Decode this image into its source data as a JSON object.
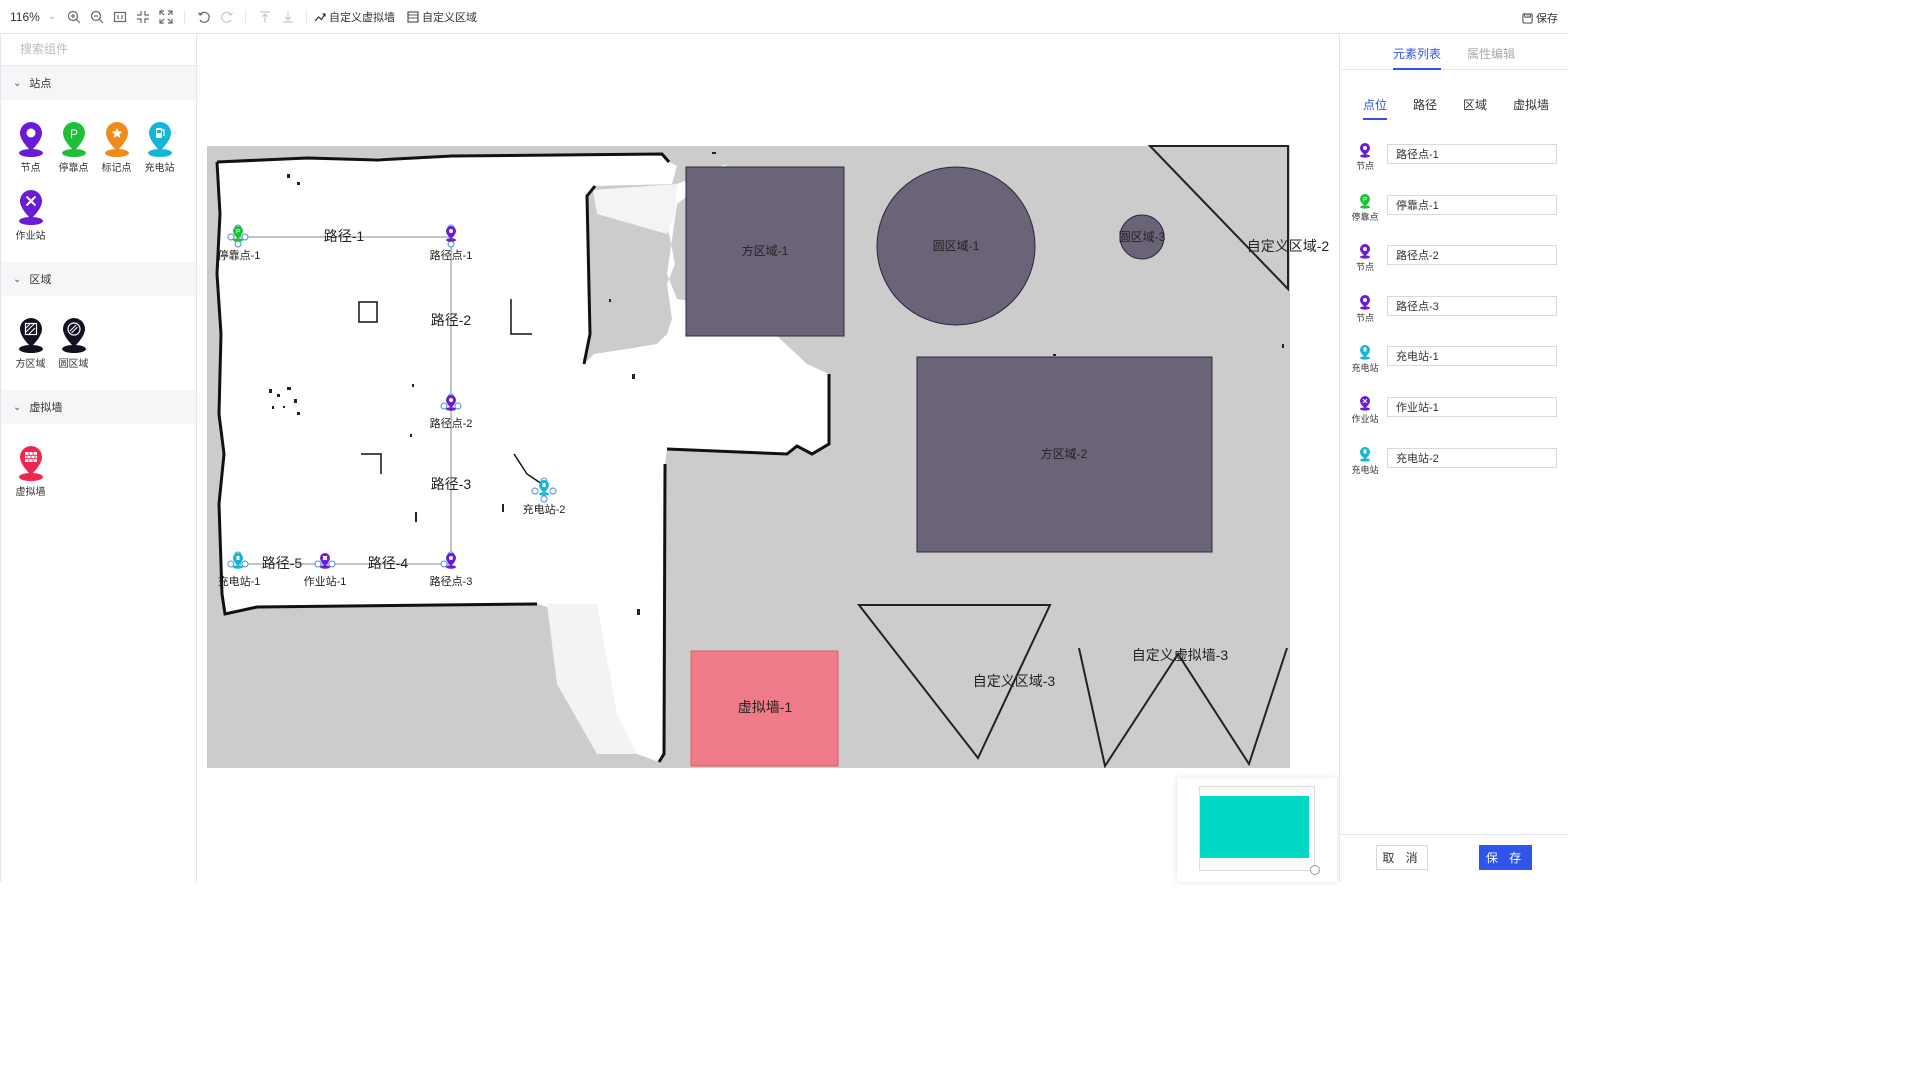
{
  "toolbar": {
    "zoom": "116%",
    "custom_wall_label": "自定义虚拟墙",
    "custom_area_label": "自定义区域",
    "save_label": "保存"
  },
  "left": {
    "search_placeholder": "搜索组件",
    "sections": [
      {
        "title": "站点",
        "items": [
          {
            "label": "节点",
            "icon": "node-pin",
            "color": "#6a1bd6"
          },
          {
            "label": "停靠点",
            "icon": "parking-pin",
            "color": "#1fbf3a"
          },
          {
            "label": "标记点",
            "icon": "star-pin",
            "color": "#f08b19"
          },
          {
            "label": "充电站",
            "icon": "charging-pin",
            "color": "#13b6d6"
          },
          {
            "label": "作业站",
            "icon": "tools-pin",
            "color": "#6a1bd6"
          }
        ]
      },
      {
        "title": "区域",
        "items": [
          {
            "label": "方区域",
            "icon": "square-area-pin",
            "color": "#111122"
          },
          {
            "label": "圆区域",
            "icon": "circle-area-pin",
            "color": "#111122"
          }
        ]
      },
      {
        "title": "虚拟墙",
        "items": [
          {
            "label": "虚拟墙",
            "icon": "wall-pin",
            "color": "#f0264e"
          }
        ]
      }
    ]
  },
  "map": {
    "background_color": "#cccccc",
    "area_fill": "#6b6478",
    "wall_fill": "#ee7b87",
    "nodes": {
      "parking1": "停靠点-1",
      "path_pt1": "路径点-1",
      "path_pt2": "路径点-2",
      "path_pt3": "路径点-3",
      "charge1": "充电站-1",
      "work1": "作业站-1",
      "charge2": "充电站-2"
    },
    "paths": {
      "p1": "路径-1",
      "p2": "路径-2",
      "p3": "路径-3",
      "p4": "路径-4",
      "p5": "路径-5"
    },
    "areas": {
      "square1": "方区域-1",
      "circle1": "圆区域-1",
      "circle3": "圆区域-3",
      "custom2": "自定义区域-2",
      "square2": "方区域-2",
      "custom3": "自定义区域-3",
      "wall1": "虚拟墙-1",
      "custom_wall3": "自定义虚拟墙-3"
    }
  },
  "right": {
    "tabs": [
      "元素列表",
      "属性编辑"
    ],
    "subtabs": [
      "点位",
      "路径",
      "区域",
      "虚拟墙"
    ],
    "elements": [
      {
        "type": "节点",
        "value": "路径点-1",
        "color": "#6a1bd6"
      },
      {
        "type": "停靠点",
        "value": "停靠点-1",
        "color": "#1fbf3a"
      },
      {
        "type": "节点",
        "value": "路径点-2",
        "color": "#6a1bd6"
      },
      {
        "type": "节点",
        "value": "路径点-3",
        "color": "#6a1bd6"
      },
      {
        "type": "充电站",
        "value": "充电站-1",
        "color": "#13b6d6"
      },
      {
        "type": "作业站",
        "value": "作业站-1",
        "color": "#6a1bd6"
      },
      {
        "type": "充电站",
        "value": "充电站-2",
        "color": "#13b6d6"
      }
    ],
    "cancel_label": "取 消",
    "save_label": "保 存"
  }
}
